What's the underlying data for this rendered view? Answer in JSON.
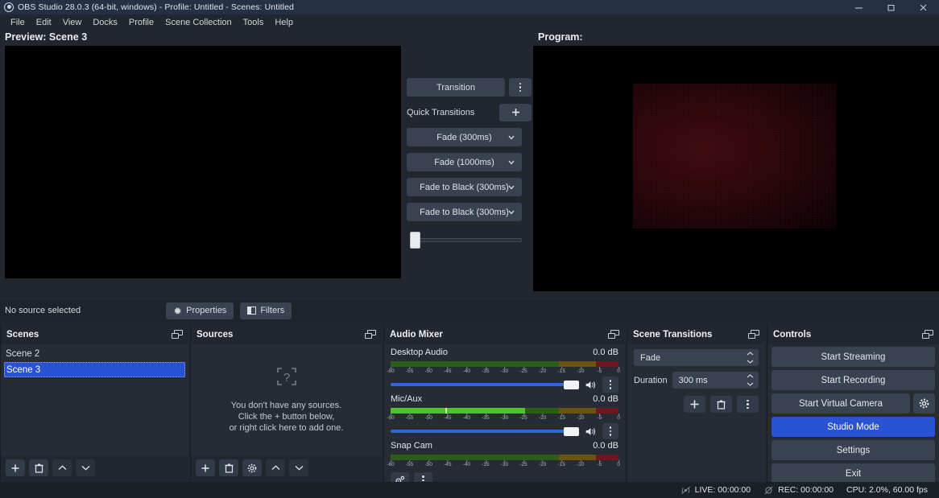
{
  "window": {
    "title": "OBS Studio 28.0.3 (64-bit, windows) - Profile: Untitled - Scenes: Untitled",
    "logo_icon": "obs-logo-icon",
    "minimize_icon": "minimize-icon",
    "maximize_icon": "restore-icon",
    "close_icon": "close-icon"
  },
  "menubar": {
    "items": [
      {
        "label": "File"
      },
      {
        "label": "Edit"
      },
      {
        "label": "View"
      },
      {
        "label": "Docks"
      },
      {
        "label": "Profile"
      },
      {
        "label": "Scene Collection"
      },
      {
        "label": "Tools"
      },
      {
        "label": "Help"
      }
    ]
  },
  "preview": {
    "label": "Preview: Scene 3"
  },
  "program": {
    "label": "Program:"
  },
  "transitions_center": {
    "transition_button": "Transition",
    "menu_icon": "kebab-menu-icon",
    "quick_transitions_label": "Quick Transitions",
    "add_icon": "plus-icon",
    "quick": [
      {
        "label": "Fade (300ms)"
      },
      {
        "label": "Fade (1000ms)"
      },
      {
        "label": "Fade to Black (300ms)"
      },
      {
        "label": "Fade to Black (300ms)"
      }
    ],
    "tbar_position_percent": 0
  },
  "source_toolbar": {
    "status": "No source selected",
    "properties_label": "Properties",
    "properties_icon": "gear-icon",
    "filters_label": "Filters",
    "filters_icon": "filters-icon"
  },
  "scenes": {
    "title": "Scenes",
    "float_icon": "undock-icon",
    "items": [
      {
        "label": "Scene 2",
        "selected": false
      },
      {
        "label": "Scene 3",
        "selected": true
      }
    ],
    "toolbar": [
      {
        "icon": "plus-icon",
        "name": "add-scene-button"
      },
      {
        "icon": "trash-icon",
        "name": "remove-scene-button"
      },
      {
        "icon": "chevron-up-icon",
        "name": "move-scene-up-button"
      },
      {
        "icon": "chevron-down-icon",
        "name": "move-scene-down-button"
      }
    ]
  },
  "sources": {
    "title": "Sources",
    "float_icon": "undock-icon",
    "empty_icon": "question-mark-icon",
    "empty_lines": [
      "You don't have any sources.",
      "Click the + button below,",
      "or right click here to add one."
    ],
    "toolbar": [
      {
        "icon": "plus-icon",
        "name": "add-source-button"
      },
      {
        "icon": "trash-icon",
        "name": "remove-source-button"
      },
      {
        "icon": "gear-icon",
        "name": "source-properties-button"
      },
      {
        "icon": "chevron-up-icon",
        "name": "move-source-up-button"
      },
      {
        "icon": "chevron-down-icon",
        "name": "move-source-down-button"
      }
    ]
  },
  "audio_mixer": {
    "title": "Audio Mixer",
    "float_icon": "undock-icon",
    "tick_labels": [
      "-60",
      "-55",
      "-50",
      "-45",
      "-40",
      "-35",
      "-30",
      "-25",
      "-20",
      "-15",
      "-10",
      "-5",
      "0"
    ],
    "tracks": [
      {
        "name": "Desktop Audio",
        "db": "0.0 dB",
        "level_percent": 0,
        "peak_percent": 0,
        "volume_percent": 100,
        "muted": false,
        "speaker_icon": "speaker-icon",
        "menu_icon": "kebab-menu-icon"
      },
      {
        "name": "Mic/Aux",
        "db": "0.0 dB",
        "level_percent": 59,
        "peak_percent": 24,
        "volume_percent": 100,
        "muted": false,
        "speaker_icon": "speaker-icon",
        "menu_icon": "kebab-menu-icon"
      },
      {
        "name": "Snap Cam",
        "db": "0.0 dB",
        "level_percent": 0,
        "peak_percent": 0,
        "volume_percent": 100,
        "muted": false,
        "speaker_icon": "speaker-icon",
        "menu_icon": "kebab-menu-icon"
      }
    ],
    "footer": [
      {
        "icon": "advanced-audio-properties-icon",
        "name": "advanced-audio-properties-button"
      },
      {
        "icon": "kebab-menu-icon",
        "name": "audio-mixer-menu-button"
      }
    ]
  },
  "scene_transitions": {
    "title": "Scene Transitions",
    "float_icon": "undock-icon",
    "transition_value": "Fade",
    "duration_label": "Duration",
    "duration_value": "300 ms",
    "toolbar": [
      {
        "icon": "plus-icon",
        "name": "add-transition-button"
      },
      {
        "icon": "trash-icon",
        "name": "remove-transition-button"
      },
      {
        "icon": "kebab-menu-icon",
        "name": "transition-properties-button"
      }
    ]
  },
  "controls": {
    "title": "Controls",
    "float_icon": "undock-icon",
    "start_streaming": "Start Streaming",
    "start_recording": "Start Recording",
    "start_virtual_camera": "Start Virtual Camera",
    "virtual_camera_settings_icon": "gear-icon",
    "studio_mode": "Studio Mode",
    "studio_mode_active": true,
    "settings": "Settings",
    "exit": "Exit",
    "accent_color": "#2a53d4"
  },
  "statusbar": {
    "live_icon": "broadcast-off-icon",
    "live": "LIVE: 00:00:00",
    "rec_icon": "record-off-icon",
    "rec": "REC: 00:00:00",
    "cpu": "CPU: 2.0%, 60.00 fps"
  }
}
